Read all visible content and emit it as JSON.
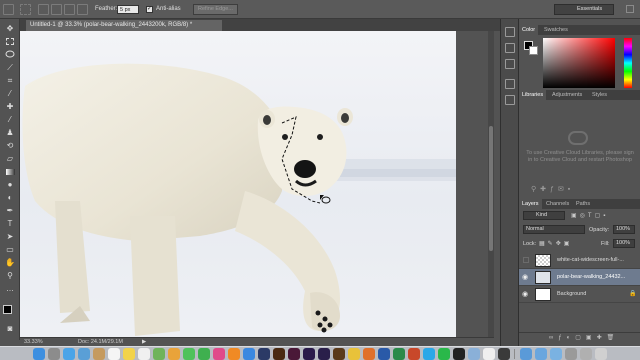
{
  "options_bar": {
    "feather_label": "Feather:",
    "feather_value": "5 px",
    "anti_alias_label": "Anti-alias",
    "refine_edge_label": "Refine Edge...",
    "workspace": "Essentials"
  },
  "document": {
    "tab_title": "Untitled-1 @ 33.3% (polar-bear-walking_2443200k, RGB/8) *",
    "zoom": "33.33%",
    "doc_size": "Doc: 24.1M/29.1M"
  },
  "color_panel": {
    "tabs": [
      "Color",
      "Swatches"
    ],
    "hue_color": "#ff0000"
  },
  "libraries_panel": {
    "tabs": [
      "Libraries",
      "Adjustments",
      "Styles"
    ],
    "message": "To use Creative Cloud Libraries, please sign in to Creative Cloud and restart Photoshop"
  },
  "layers_panel": {
    "tabs": [
      "Layers",
      "Channels",
      "Paths"
    ],
    "filter_kind": "Kind",
    "blend_mode": "Normal",
    "opacity_label": "Opacity:",
    "opacity_value": "100%",
    "lock_label": "Lock:",
    "fill_label": "Fill:",
    "fill_value": "100%",
    "layers": [
      {
        "name": "white-cat-widescreen-full-...",
        "visible": false,
        "selected": false
      },
      {
        "name": "polar-bear-walking_24432...",
        "visible": true,
        "selected": true
      },
      {
        "name": "Background",
        "visible": true,
        "selected": false
      }
    ]
  },
  "dock": {
    "icons": [
      "finder-icon",
      "launchpad-icon",
      "safari-icon",
      "mail-icon",
      "contacts-icon",
      "calendar-icon",
      "notes-icon",
      "reminders-icon",
      "maps-icon",
      "photos-icon",
      "messages-icon",
      "facetime-icon",
      "itunes-icon",
      "ibooks-icon",
      "app-store-icon",
      "system-preferences-icon",
      "photoshop-icon",
      "illustrator-icon",
      "indesign-icon",
      "premiere-icon",
      "after-effects-icon",
      "bridge-icon",
      "chrome-icon",
      "firefox-icon",
      "word-icon",
      "excel-icon",
      "powerpoint-icon",
      "skype-icon",
      "spotify-icon",
      "terminal-icon",
      "preview-icon",
      "textedit-icon",
      "quicktime-icon",
      "downloads-icon",
      "documents-icon",
      "trash-icon"
    ]
  }
}
